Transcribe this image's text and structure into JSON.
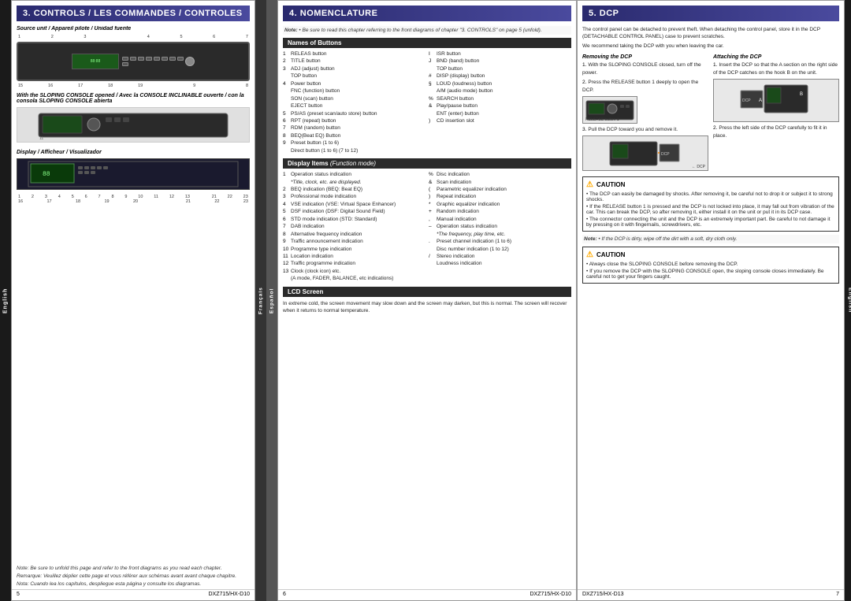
{
  "panels": {
    "left": {
      "number": "3.",
      "title": "CONTROLS / LES COMMANDES / CONTROLES",
      "source_label": "Source unit / Appareil pilote / Unidad fuente",
      "console_label": "With the SLOPING CONSOLE opened / Avec la CONSOLE INCLINABLE ouverte / con la consola SLOPING CONSOLE abierta",
      "display_label": "Display / Afficheur / Visualizador",
      "note": "Note: Be sure to unfold this page and refer to the front diagrams as you read each chapter.",
      "note2": "Remarque: Veuillez déplier cette page et vous référer aux schémas avant avant chaque chapitre.",
      "note3": "Nota: Cuando lea los capítulos, despliegue esta página y consulte los diagramas.",
      "page_num": "5",
      "page_code": "DXZ715/HX-D10"
    },
    "mid": {
      "number": "4.",
      "title": "NOMENCLATURE",
      "note": "Note:",
      "note_text": "• Be sure to read this chapter referring to the front diagrams of chapter \"3. CONTROLS\" on page 5 (unfold).",
      "names_header": "Names of Buttons",
      "buttons": [
        {
          "num": "1",
          "text": "RELEAS button"
        },
        {
          "num": "2",
          "text": "TITLE button"
        },
        {
          "num": "3",
          "text": "ADJ (adjust) button"
        },
        {
          "num": "",
          "text": "TOP button"
        },
        {
          "num": "4",
          "text": "Power button"
        },
        {
          "num": "",
          "text": "FNC (function) button"
        },
        {
          "num": "",
          "text": "SON (scan) button"
        },
        {
          "num": "",
          "text": "EJECT button"
        },
        {
          "num": "5",
          "text": "PS/AS (preset scan/auto store) button"
        },
        {
          "num": "6",
          "text": "RPT (repeat) button"
        },
        {
          "num": "7",
          "text": "RDM (random) button"
        },
        {
          "num": "8",
          "text": "BEQ(Beat EQ) Button"
        },
        {
          "num": "9",
          "text": "Preset button (1 to 6)"
        },
        {
          "num": "",
          "text": "Direct button (1 to 6) (7 to 12)"
        }
      ],
      "buttons_right": [
        {
          "num": "I",
          "text": "ISR button"
        },
        {
          "num": "J",
          "text": "BND (band) button"
        },
        {
          "num": "",
          "text": "TOP button"
        },
        {
          "num": "#",
          "text": "DISP (display) button"
        },
        {
          "num": "§",
          "text": "LOUD (loudness) button"
        },
        {
          "num": "",
          "text": "A/M (audio mode) button"
        },
        {
          "num": "%",
          "text": "SEARCH button"
        },
        {
          "num": "&",
          "text": "Play/pause button"
        },
        {
          "num": "",
          "text": "ENT (enter) button"
        },
        {
          "num": ")",
          "text": "CD insertion slot"
        }
      ],
      "display_header": "Display Items (Function mode)",
      "display_items_left": [
        {
          "num": "1",
          "text": "Operation status indication"
        },
        {
          "num": "",
          "text": "*Title, clock, etc. are displayed."
        },
        {
          "num": "2",
          "text": "BEQ indication (BEQ: Beat EQ)"
        },
        {
          "num": "3",
          "text": "Professional mode indication"
        },
        {
          "num": "4",
          "text": "VSE indication (VSE: Virtual Space Enhancer)"
        },
        {
          "num": "5",
          "text": "DSF indication (DSF: Digital Sound Field)"
        },
        {
          "num": "6",
          "text": "STD mode indication (STD: Standard)"
        },
        {
          "num": "7",
          "text": "DAB indication"
        },
        {
          "num": "8",
          "text": "Alternative frequency indication"
        },
        {
          "num": "9",
          "text": "Traffic announcement indication"
        },
        {
          "num": "10",
          "text": "Programme type indication"
        },
        {
          "num": "11",
          "text": "Location indication"
        },
        {
          "num": "12",
          "text": "Traffic programme indication"
        },
        {
          "num": "13",
          "text": "Clock (clock icon) etc."
        },
        {
          "num": "",
          "text": "(A mode, FADER, BALANCE, etc indications)"
        }
      ],
      "display_items_right": [
        {
          "num": "%",
          "text": "Disc indication"
        },
        {
          "num": "&",
          "text": "Scan indication"
        },
        {
          "num": "(",
          "text": "Parametric equalizer indication"
        },
        {
          "num": ")",
          "text": "Repeat indication"
        },
        {
          "num": "*",
          "text": "Graphic equalizer indication"
        },
        {
          "num": "+",
          "text": "Random indication"
        },
        {
          "num": ",",
          "text": "Manual indication"
        },
        {
          "num": "-",
          "text": "Operation status indication"
        },
        {
          "num": "",
          "text": "*The frequency, play time, etc."
        },
        {
          "num": ".",
          "text": "Preset channel indication (1 to 6)"
        },
        {
          "num": "",
          "text": "Disc number indication (1 to 12)"
        },
        {
          "num": "/",
          "text": "Stereo indication"
        },
        {
          "num": "",
          "text": "Loudness indication"
        }
      ],
      "lcd_header": "LCD Screen",
      "lcd_text": "In extreme cold, the screen movement may slow down and the screen may darken, but this is normal. The screen will recover when it returns to normal temperature.",
      "page_num": "6",
      "page_code": "DXZ715/HX-D10"
    },
    "right": {
      "number": "5.",
      "title": "DCP",
      "intro_text": "The control panel can be detached to prevent theft. When detaching the control panel, store it in the DCP (DETACHABLE CONTROL PANEL) case to prevent scratches.",
      "manage_text": "We recommend taking the DCP with you when leaving the car.",
      "removing_header": "Removing the DCP",
      "removing_steps": [
        {
          "num": "1.",
          "text": "With the SLOPING CONSOLE closed, turn off the power."
        },
        {
          "num": "2.",
          "text": "Press the RELEASE button 1  deeply to open the DCP."
        },
        {
          "num": "3.",
          "text": "Pull the DCP toward you and remove it."
        }
      ],
      "attaching_header": "Attaching the DCP",
      "attaching_steps": [
        {
          "num": "1.",
          "text": "Insert the DCP so that the A  section on the right side of the DCP catches on the hook B  on the unit."
        },
        {
          "num": "2.",
          "text": "Press the left side of the DCP carefully to fit it in place."
        }
      ],
      "caution1_title": "CAUTION",
      "caution1_items": [
        "• The DCP can easily be damaged by shocks. After removing it, be careful not to drop it or subject it to strong shocks.",
        "• If the RELEASE button 1  is pressed and the DCP is not locked into place, it may fall out from vibration of the car. This can break the DCP, so after removing it, either install it on the unit or put it in its DCP case.",
        "• The connector connecting the unit and the DCP is an extremely important part. Be careful to not damage it by pressing on it with fingernails, screwdrivers, etc."
      ],
      "note_dcp": "Note:",
      "note_dcp_text": "• If the DCP is dirty, wipe off the dirt with a soft, dry cloth only.",
      "caution2_title": "CAUTION",
      "caution2_items": [
        "• Always close the SLOPING CONSOLE before removing the DCP.",
        "• If you remove the DCP with the SLOPING CONSOLE open, the sloping console closes immediately. Be careful not to get your fingers caught."
      ],
      "release_label": "RELEASE button 1",
      "dcp_label": "DCP",
      "dcp_label2": "DCP",
      "page_num": "7",
      "page_code": "DXZ715/HX-D13"
    }
  },
  "labels": {
    "english": "English",
    "francais": "Français",
    "espanol": "Español"
  }
}
